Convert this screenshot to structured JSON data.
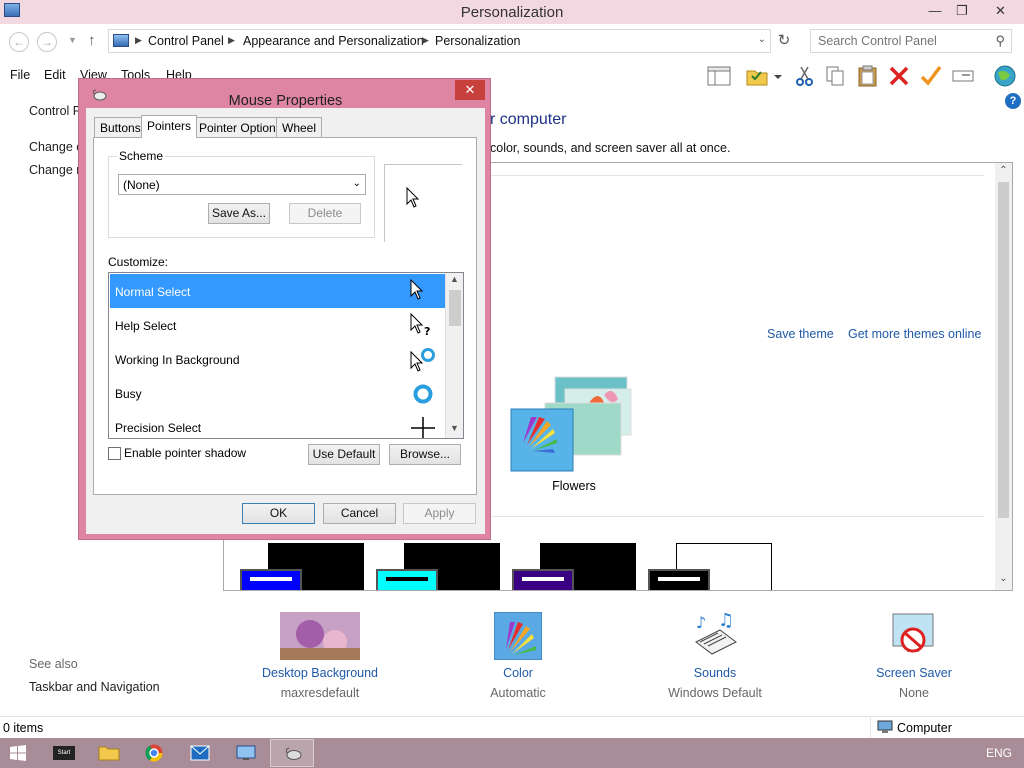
{
  "window": {
    "title": "Personalization",
    "minimize": "—",
    "restore": "❐",
    "close": "✕"
  },
  "address": {
    "breadcrumbs": [
      "Control Panel",
      "Appearance and Personalization",
      "Personalization"
    ],
    "search_placeholder": "Search Control Panel"
  },
  "menu": [
    "File",
    "Edit",
    "View",
    "Tools",
    "Help"
  ],
  "left_panel": {
    "links": [
      "Control P",
      "Change c",
      "Change m"
    ],
    "see_also_label": "See also",
    "see_also_links": [
      "Taskbar and Navigation"
    ]
  },
  "main": {
    "heading_visible": "r computer",
    "description_visible": "color, sounds, and screen saver all at once.",
    "save_theme": "Save theme",
    "get_more_themes": "Get more themes online",
    "selected_theme": "Flowers"
  },
  "bottom_items": [
    {
      "label": "Desktop Background",
      "sub": "maxresdefault"
    },
    {
      "label": "Color",
      "sub": "Automatic"
    },
    {
      "label": "Sounds",
      "sub": "Windows Default"
    },
    {
      "label": "Screen Saver",
      "sub": "None"
    }
  ],
  "status": {
    "items": "0 items",
    "location": "Computer"
  },
  "taskbar": {
    "lang": "ENG",
    "start_thumb": "Start"
  },
  "dialog": {
    "title": "Mouse Properties",
    "close": "✕",
    "tabs": [
      "Buttons",
      "Pointers",
      "Pointer Options",
      "Wheel"
    ],
    "active_tab": "Pointers",
    "scheme_label": "Scheme",
    "scheme_value": "(None)",
    "save_as": "Save As...",
    "delete": "Delete",
    "customize_label": "Customize:",
    "pointers": [
      {
        "name": "Normal Select",
        "icon": "arrow-cursor-icon"
      },
      {
        "name": "Help Select",
        "icon": "help-cursor-icon"
      },
      {
        "name": "Working In Background",
        "icon": "working-cursor-icon"
      },
      {
        "name": "Busy",
        "icon": "busy-cursor-icon"
      },
      {
        "name": "Precision Select",
        "icon": "crosshair-cursor-icon"
      }
    ],
    "selected_pointer": "Normal Select",
    "enable_shadow": "Enable pointer shadow",
    "use_default": "Use Default",
    "browse": "Browse...",
    "ok": "OK",
    "cancel": "Cancel",
    "apply": "Apply"
  },
  "colors": {
    "titlebar": "#f2d8e1",
    "dialog_frame": "#df85a4",
    "selection": "#3399ff",
    "link": "#1e5aa8",
    "taskbar": "#a88c97"
  }
}
